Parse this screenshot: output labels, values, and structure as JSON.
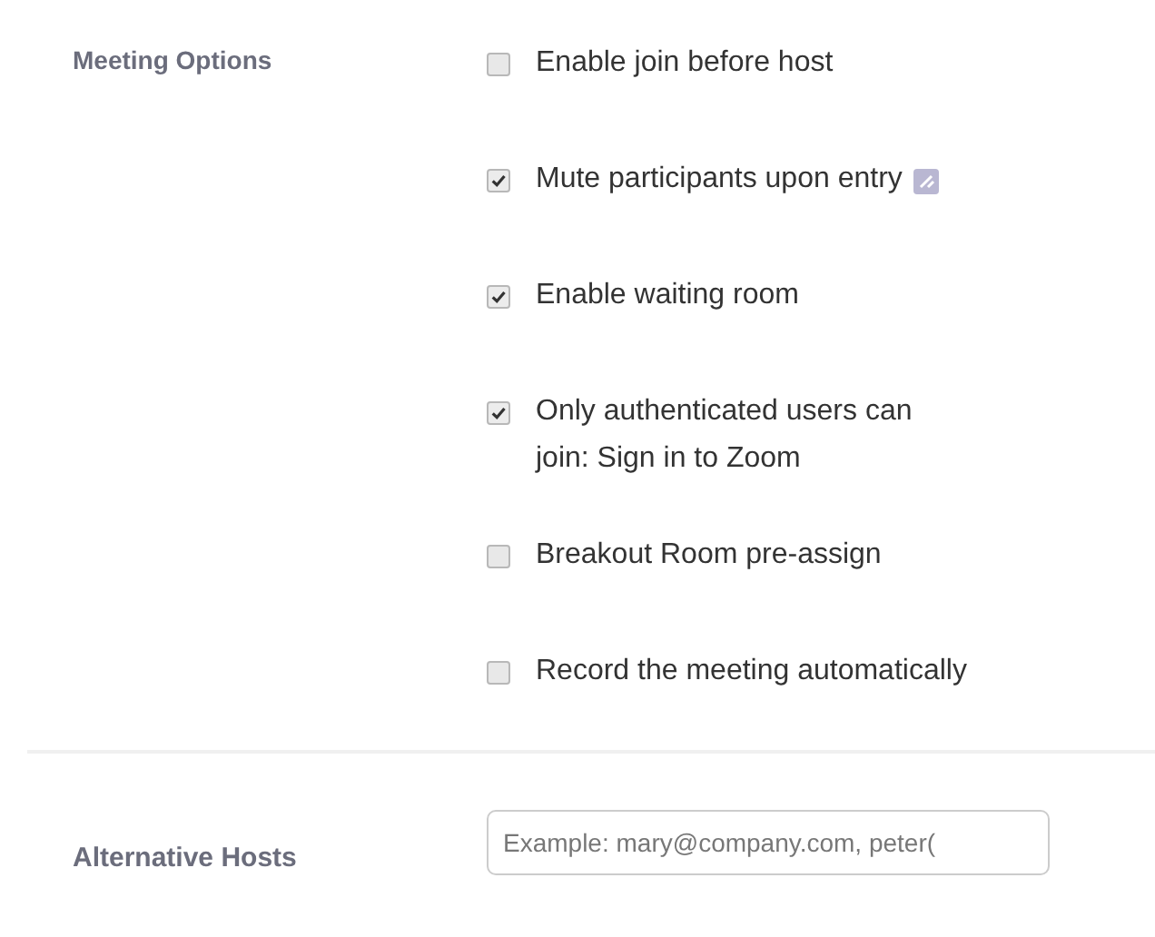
{
  "meeting_options": {
    "label": "Meeting Options",
    "options": [
      {
        "label": "Enable join before host",
        "checked": false,
        "info_icon": false
      },
      {
        "label": "Mute participants upon entry",
        "checked": true,
        "info_icon": true
      },
      {
        "label": "Enable waiting room",
        "checked": true,
        "info_icon": false
      },
      {
        "label": "Only authenticated users can join: Sign in to Zoom",
        "checked": true,
        "info_icon": false
      },
      {
        "label": "Breakout Room pre-assign",
        "checked": false,
        "info_icon": false
      },
      {
        "label": "Record the meeting automatically",
        "checked": false,
        "info_icon": false
      }
    ]
  },
  "alternative_hosts": {
    "label": "Alternative Hosts",
    "placeholder": "Example: mary@company.com, peter("
  }
}
